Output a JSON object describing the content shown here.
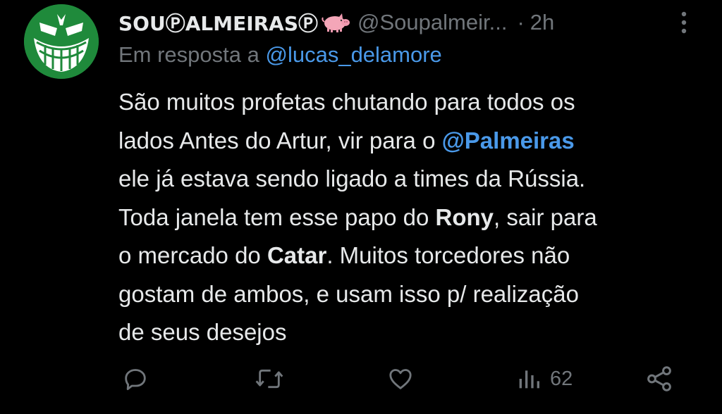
{
  "tweet": {
    "author": {
      "display_name": "SOUⓅALMEIRASⓅ",
      "emoji_icon": "pig-icon",
      "handle": "@Soupalmeir...",
      "separator": "·",
      "time": "2h"
    },
    "reply": {
      "prefix": "Em resposta a ",
      "to_handle": "@lucas_delamore"
    },
    "body": {
      "line1": "São muitos profetas chutando para todos os",
      "line2_a": "lados Antes do Artur, vir para o ",
      "line2_mention": "@Palmeiras",
      "line3": "ele já estava sendo ligado a times da Rússia.",
      "line4_a": "Toda janela tem esse papo do ",
      "line4_bold": "Rony",
      "line4_b": ", sair para",
      "line5_a": "o mercado do ",
      "line5_bold": "Catar",
      "line5_b": ".  Muitos torcedores não",
      "line6": "gostam de ambos, e usam isso p/ realização",
      "line7": "de seus desejos"
    },
    "actions": {
      "reply_icon": "reply-icon",
      "retweet_icon": "retweet-icon",
      "like_icon": "heart-icon",
      "views_icon": "views-icon",
      "views_count": "62",
      "share_icon": "share-icon"
    }
  },
  "colors": {
    "background": "#000000",
    "text": "#e7e9ea",
    "secondary": "#71767b",
    "link": "#4a99e9",
    "avatar": "#1f8a3b"
  }
}
